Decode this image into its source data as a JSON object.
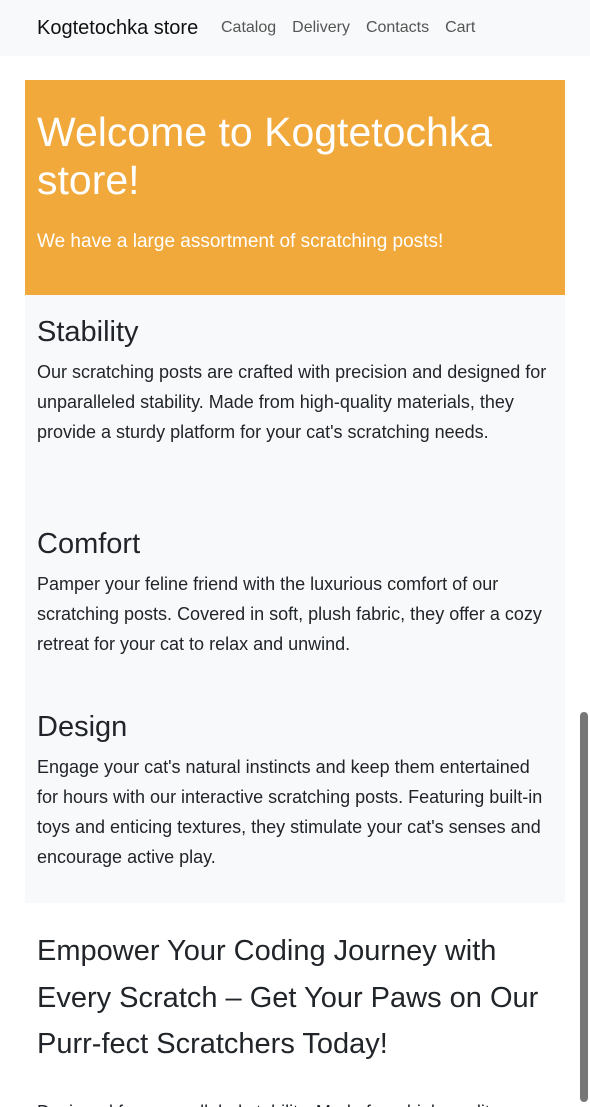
{
  "navbar": {
    "brand": "Kogtetochka store",
    "links": [
      "Catalog",
      "Delivery",
      "Contacts",
      "Cart"
    ]
  },
  "hero": {
    "title": "Welcome to Kogtetochka store!",
    "subtitle": "We have a large assortment of scratching posts!"
  },
  "features": [
    {
      "title": "Stability",
      "text": "Our scratching posts are crafted with precision and designed for unparalleled stability. Made from high-quality materials, they provide a sturdy platform for your cat's scratching needs."
    },
    {
      "title": "Comfort",
      "text": "Pamper your feline friend with the luxurious comfort of our scratching posts. Covered in soft, plush fabric, they offer a cozy retreat for your cat to relax and unwind."
    },
    {
      "title": "Design",
      "text": "Engage your cat's natural instincts and keep them entertained for hours with our interactive scratching posts. Featuring built-in toys and enticing textures, they stimulate your cat's senses and encourage active play."
    }
  ],
  "slogan": "Empower Your Coding Journey with Every Scratch – Get Your Paws on Our Purr-fect Scratchers Today!",
  "cut_text": "Designed for unparalleled stability. Made from high-quality"
}
